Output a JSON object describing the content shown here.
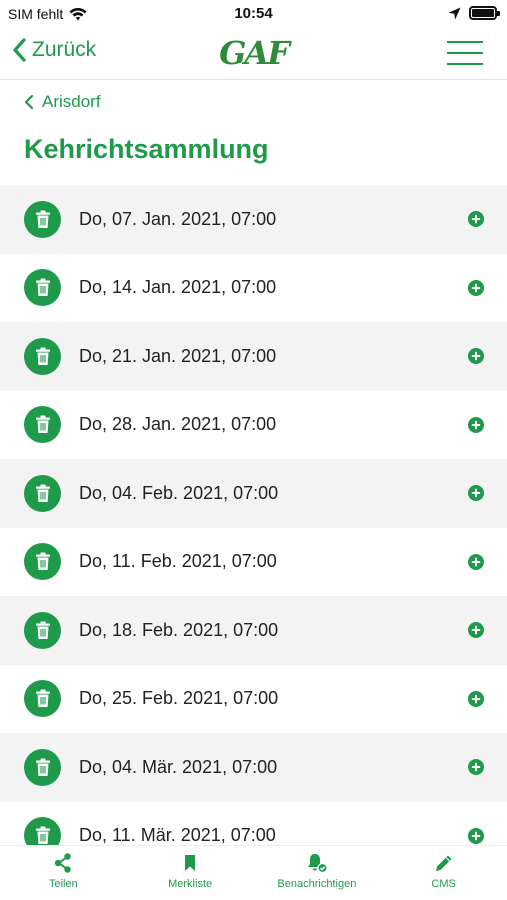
{
  "status_bar": {
    "carrier": "SIM fehlt",
    "time": "10:54",
    "icons": [
      "wifi-icon",
      "location-arrow-icon",
      "battery-icon"
    ]
  },
  "nav": {
    "back_label": "Zurück",
    "logo_text": "GAF",
    "menu_icon": "hamburger-menu-icon"
  },
  "breadcrumb": {
    "label": "Arisdorf"
  },
  "page": {
    "title": "Kehrichtsammlung"
  },
  "colors": {
    "accent": "#1f9a4b",
    "row_alt": "#f3f3f3"
  },
  "entries": [
    {
      "date": "Do, 07. Jan. 2021, 07:00"
    },
    {
      "date": "Do, 14. Jan. 2021, 07:00"
    },
    {
      "date": "Do, 21. Jan. 2021, 07:00"
    },
    {
      "date": "Do, 28. Jan. 2021, 07:00"
    },
    {
      "date": "Do, 04. Feb. 2021, 07:00"
    },
    {
      "date": "Do, 11. Feb. 2021, 07:00"
    },
    {
      "date": "Do, 18. Feb. 2021, 07:00"
    },
    {
      "date": "Do, 25. Feb. 2021, 07:00"
    },
    {
      "date": "Do, 04. Mär. 2021, 07:00"
    },
    {
      "date": "Do, 11. Mär. 2021, 07:00"
    }
  ],
  "tabs": [
    {
      "label": "Teilen",
      "icon": "share-icon"
    },
    {
      "label": "Merkliste",
      "icon": "bookmark-icon"
    },
    {
      "label": "Benachrichtigen",
      "icon": "bell-check-icon"
    },
    {
      "label": "CMS",
      "icon": "pencil-icon"
    }
  ]
}
